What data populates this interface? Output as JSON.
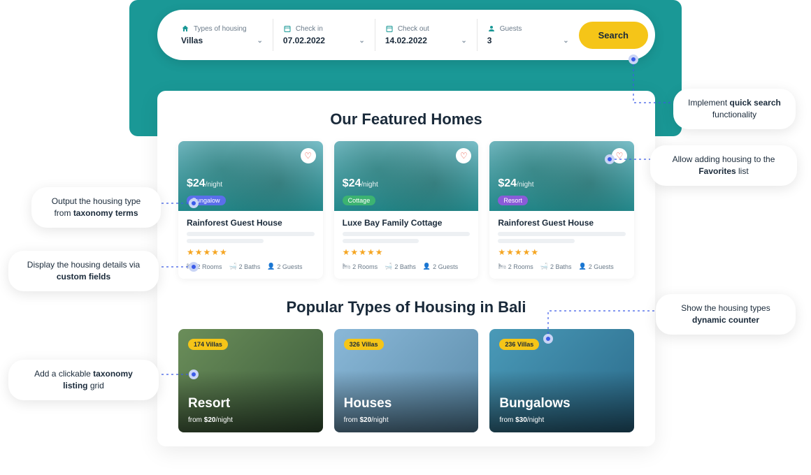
{
  "search": {
    "housing_label": "Types of housing",
    "housing_value": "Villas",
    "checkin_label": "Check in",
    "checkin_value": "07.02.2022",
    "checkout_label": "Check out",
    "checkout_value": "14.02.2022",
    "guests_label": "Guests",
    "guests_value": "3",
    "button": "Search"
  },
  "featured": {
    "title": "Our Featured Homes",
    "cards": [
      {
        "price": "$24",
        "per": "/night",
        "tag": "Bungalow",
        "title": "Rainforest Guest House",
        "rooms": "2 Rooms",
        "baths": "2 Baths",
        "guests": "2 Guests"
      },
      {
        "price": "$24",
        "per": "/night",
        "tag": "Cottage",
        "title": "Luxe Bay Family Cottage",
        "rooms": "2 Rooms",
        "baths": "2 Baths",
        "guests": "2 Guests"
      },
      {
        "price": "$24",
        "per": "/night",
        "tag": "Resort",
        "title": "Rainforest Guest House",
        "rooms": "2 Rooms",
        "baths": "2 Baths",
        "guests": "2 Guests"
      }
    ]
  },
  "types": {
    "title": "Popular Types of Housing in Bali",
    "items": [
      {
        "count": "174 Villas",
        "name": "Resort",
        "from_prefix": "from ",
        "from_price": "$20",
        "from_suffix": "/night"
      },
      {
        "count": "326 Villas",
        "name": "Houses",
        "from_prefix": "from ",
        "from_price": "$20",
        "from_suffix": "/night"
      },
      {
        "count": "236 Villas",
        "name": "Bungalows",
        "from_prefix": "from ",
        "from_price": "$30",
        "from_suffix": "/night"
      }
    ]
  },
  "callouts": {
    "quick_search_a": "Implement ",
    "quick_search_b": "quick search",
    "quick_search_c": " functionality",
    "favorites_a": "Allow adding housing to the ",
    "favorites_b": "Favorites",
    "favorites_c": " list",
    "taxonomy_a": "Output the housing type from ",
    "taxonomy_b": "taxonomy terms",
    "custom_fields_a": "Display the housing details via ",
    "custom_fields_b": "custom fields",
    "counter_a": "Show the housing types ",
    "counter_b": "dynamic counter",
    "listing_a": "Add a clickable ",
    "listing_b": "taxonomy listing",
    "listing_c": " grid"
  }
}
